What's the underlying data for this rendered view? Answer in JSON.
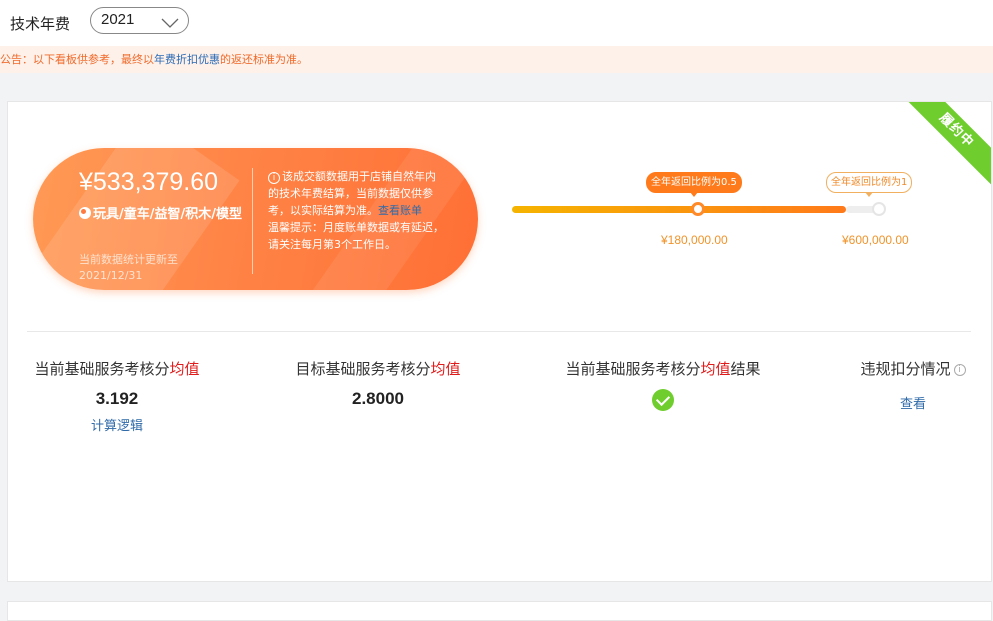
{
  "header": {
    "label": "技术年费",
    "year": "2021"
  },
  "notice": {
    "prefix": "公告：以下看板供参考，最终以",
    "link": "年费折扣优惠",
    "suffix": "的返还标准为准。"
  },
  "ribbon": "履约中",
  "summary": {
    "amount": "¥533,379.60",
    "category": "玩具/童车/益智/积木/模型",
    "update_text": "当前数据统计更新至2021/12/31",
    "note_text": "该成交额数据用于店铺自然年内的技术年费结算，当前数据仅供参考，以实际结算为准。",
    "note_link": "查看账单",
    "tip_text": "温馨提示：月度账单数据或有延迟，请关注每月第3个工作日。"
  },
  "progress": {
    "fill_fraction": 0.9,
    "milestones": [
      {
        "label": "全年返回比例为0.5",
        "price": "¥180,000.00"
      },
      {
        "label": "全年返回比例为1",
        "price": "¥600,000.00"
      }
    ]
  },
  "metrics": {
    "current": {
      "title_pre": "当前基础服务考核分",
      "title_red": "均值",
      "value": "3.192",
      "link": "计算逻辑"
    },
    "target": {
      "title_pre": "目标基础服务考核分",
      "title_red": "均值",
      "value": "2.8000"
    },
    "result": {
      "title_pre": "当前基础服务考核分",
      "title_red": "均值",
      "title_post": "结果"
    },
    "violation": {
      "title": "违规扣分情况",
      "link": "查看"
    }
  },
  "colors": {
    "accent": "#ff7a1a",
    "success": "#6fce2d",
    "link": "#2f6aa8",
    "alert": "#e01b1b"
  }
}
